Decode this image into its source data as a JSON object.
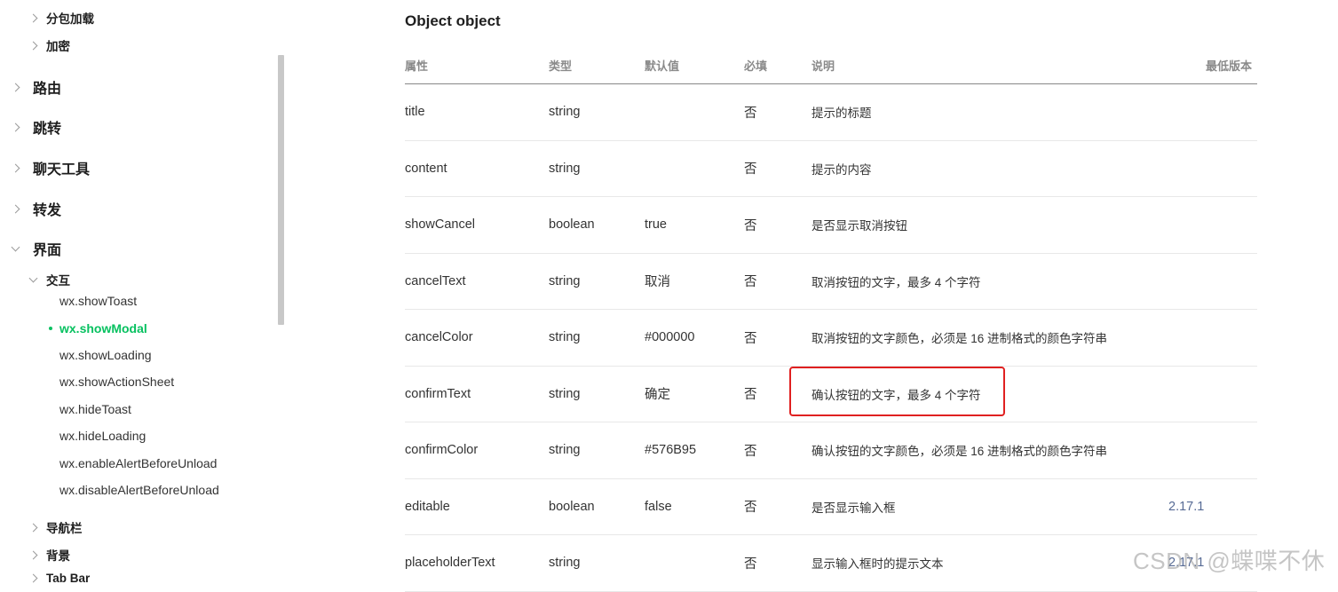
{
  "sidebar": {
    "sub_categories_top": [
      {
        "label": "分包加载"
      },
      {
        "label": "加密"
      }
    ],
    "top_categories": [
      {
        "label": "路由"
      },
      {
        "label": "跳转"
      },
      {
        "label": "聊天工具"
      },
      {
        "label": "转发"
      },
      {
        "label": "界面"
      }
    ],
    "interaction_group": {
      "label": "交互"
    },
    "leaves": [
      {
        "label": "wx.showToast"
      },
      {
        "label": "wx.showModal"
      },
      {
        "label": "wx.showLoading"
      },
      {
        "label": "wx.showActionSheet"
      },
      {
        "label": "wx.hideToast"
      },
      {
        "label": "wx.hideLoading"
      },
      {
        "label": "wx.enableAlertBeforeUnload"
      },
      {
        "label": "wx.disableAlertBeforeUnload"
      }
    ],
    "active_leaf": "wx.showModal",
    "sub_categories_bottom": [
      {
        "label": "导航栏"
      },
      {
        "label": "背景"
      },
      {
        "label": "Tab Bar"
      }
    ]
  },
  "main": {
    "section_title": "Object object",
    "columns": [
      "属性",
      "类型",
      "默认值",
      "必填",
      "说明",
      "最低版本"
    ],
    "rows": [
      {
        "name": "title",
        "type": "string",
        "default": "",
        "required": "否",
        "desc": "提示的标题",
        "version": ""
      },
      {
        "name": "content",
        "type": "string",
        "default": "",
        "required": "否",
        "desc": "提示的内容",
        "version": ""
      },
      {
        "name": "showCancel",
        "type": "boolean",
        "default": "true",
        "required": "否",
        "desc": "是否显示取消按钮",
        "version": ""
      },
      {
        "name": "cancelText",
        "type": "string",
        "default": "取消",
        "required": "否",
        "desc": "取消按钮的文字，最多 4 个字符",
        "version": ""
      },
      {
        "name": "cancelColor",
        "type": "string",
        "default": "#000000",
        "required": "否",
        "desc": "取消按钮的文字颜色，必须是 16 进制格式的颜色字符串",
        "version": ""
      },
      {
        "name": "confirmText",
        "type": "string",
        "default": "确定",
        "required": "否",
        "desc": "确认按钮的文字，最多 4 个字符",
        "version": ""
      },
      {
        "name": "confirmColor",
        "type": "string",
        "default": "#576B95",
        "required": "否",
        "desc": "确认按钮的文字颜色，必须是 16 进制格式的颜色字符串",
        "version": ""
      },
      {
        "name": "editable",
        "type": "boolean",
        "default": "false",
        "required": "否",
        "desc": "是否显示输入框",
        "version": "2.17.1"
      },
      {
        "name": "placeholderText",
        "type": "string",
        "default": "",
        "required": "否",
        "desc": "显示输入框时的提示文本",
        "version": "2.17.1"
      }
    ]
  },
  "watermark": "CSDN @蝶喋不休",
  "colors": {
    "accent": "#07c160",
    "link": "#576b95",
    "highlight": "#e02020"
  }
}
